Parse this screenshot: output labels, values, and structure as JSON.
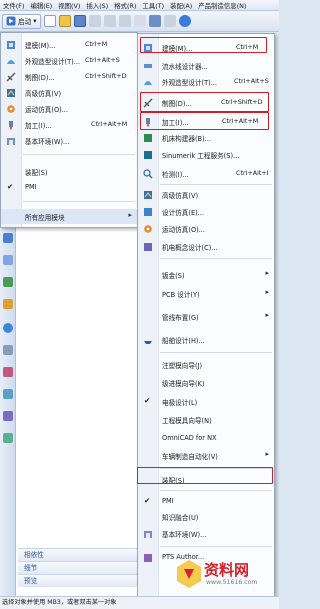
{
  "menubar": {
    "items": [
      "文件(F)",
      "编辑(E)",
      "视图(V)",
      "插入(S)",
      "格式(R)",
      "工具(T)",
      "装配(A)",
      "产品制造信息(N)"
    ]
  },
  "toolbar": {
    "start_label": "启动",
    "start_arrow": "▾"
  },
  "start_menu": {
    "items": [
      {
        "label": "建模(M)...",
        "shortcut": "Ctrl+M",
        "icon": "modeling-icon"
      },
      {
        "label": "外观造型设计(T)...",
        "shortcut": "Ctrl+Alt+S",
        "icon": "shape-studio-icon"
      },
      {
        "label": "制图(D)...",
        "shortcut": "Ctrl+Shift+D",
        "icon": "drafting-icon"
      },
      {
        "label": "高级仿真(V)",
        "shortcut": "",
        "icon": "advanced-simulation-icon"
      },
      {
        "label": "运动仿真(O)...",
        "shortcut": "",
        "icon": "motion-simulation-icon"
      },
      {
        "label": "加工(I)...",
        "shortcut": "Ctrl+Alt+M",
        "icon": "manufacturing-icon"
      },
      {
        "label": "基本环境(W)...",
        "shortcut": "",
        "icon": "gateway-icon"
      },
      {
        "label": "装配(S)",
        "shortcut": "",
        "check": false
      },
      {
        "label": "PMI",
        "shortcut": "",
        "check": true
      },
      {
        "label": "所有应用模块",
        "shortcut": "",
        "submenu": true
      }
    ]
  },
  "all_apps": {
    "items": [
      {
        "label": "建模(M)...",
        "shortcut": "Ctrl+M",
        "icon": "modeling-icon"
      },
      {
        "label": "流水线设计器...",
        "shortcut": "",
        "icon": "line-designer-icon"
      },
      {
        "label": "外观造型设计(T)...",
        "shortcut": "Ctrl+Alt+S",
        "icon": "shape-studio-icon"
      },
      {
        "label": "制图(D)...",
        "shortcut": "Ctrl+Shift+D",
        "icon": "drafting-icon"
      },
      {
        "label": "加工(I)...",
        "shortcut": "Ctrl+Alt+M",
        "icon": "manufacturing-icon"
      },
      {
        "label": "机床构建器(B)...",
        "shortcut": "",
        "icon": "machine-tool-builder-icon"
      },
      {
        "label": "Sinumerik 工程服务(S)...",
        "shortcut": "",
        "icon": "sinumerik-icon"
      },
      {
        "label": "检测(I)...",
        "shortcut": "Ctrl+Alt+I",
        "icon": "inspection-icon"
      },
      {
        "label": "高级仿真(V)",
        "shortcut": "",
        "icon": "advanced-simulation-icon"
      },
      {
        "label": "设计仿真(E)...",
        "shortcut": "",
        "icon": "design-simulation-icon"
      },
      {
        "label": "运动仿真(O)...",
        "shortcut": "",
        "icon": "motion-simulation-icon"
      },
      {
        "label": "机电概念设计(C)...",
        "shortcut": "",
        "icon": "mechatronics-icon"
      },
      {
        "label": "钣金(S)",
        "shortcut": "",
        "submenu": true
      },
      {
        "label": "PCB 设计(Y)",
        "shortcut": "",
        "submenu": true
      },
      {
        "label": "管线布置(G)",
        "shortcut": "",
        "submenu": true
      },
      {
        "label": "船舶设计(H)...",
        "shortcut": "",
        "icon": "ship-design-icon"
      },
      {
        "label": "注塑模向导(J)",
        "shortcut": ""
      },
      {
        "label": "级进模向导(K)",
        "shortcut": ""
      },
      {
        "label": "电极设计(L)",
        "shortcut": "",
        "check": true
      },
      {
        "label": "工程模具向导(N)",
        "shortcut": ""
      },
      {
        "label": "OmniCAD for NX",
        "shortcut": ""
      },
      {
        "label": "车辆制造自动化(V)",
        "shortcut": "",
        "submenu": true
      },
      {
        "label": "装配(S)",
        "shortcut": ""
      },
      {
        "label": "PMI",
        "shortcut": "",
        "check": true
      },
      {
        "label": "知识融合(U)",
        "shortcut": ""
      },
      {
        "label": "基本环境(W)...",
        "shortcut": "",
        "icon": "gateway-icon"
      },
      {
        "label": "PTS Author...",
        "shortcut": "",
        "icon": "pts-author-icon"
      }
    ]
  },
  "part_navigator": {
    "sections": [
      "相依性",
      "细节",
      "预览"
    ]
  },
  "status": {
    "text": "选择对象并使用 MB3，或者双击某一对象"
  },
  "watermark": {
    "text": "资料网",
    "url": "www.51616.com"
  },
  "colors": {
    "highlight": "#d21e2a",
    "menu_bg": "#fbfcfe",
    "accent": "#2c5a9a"
  }
}
